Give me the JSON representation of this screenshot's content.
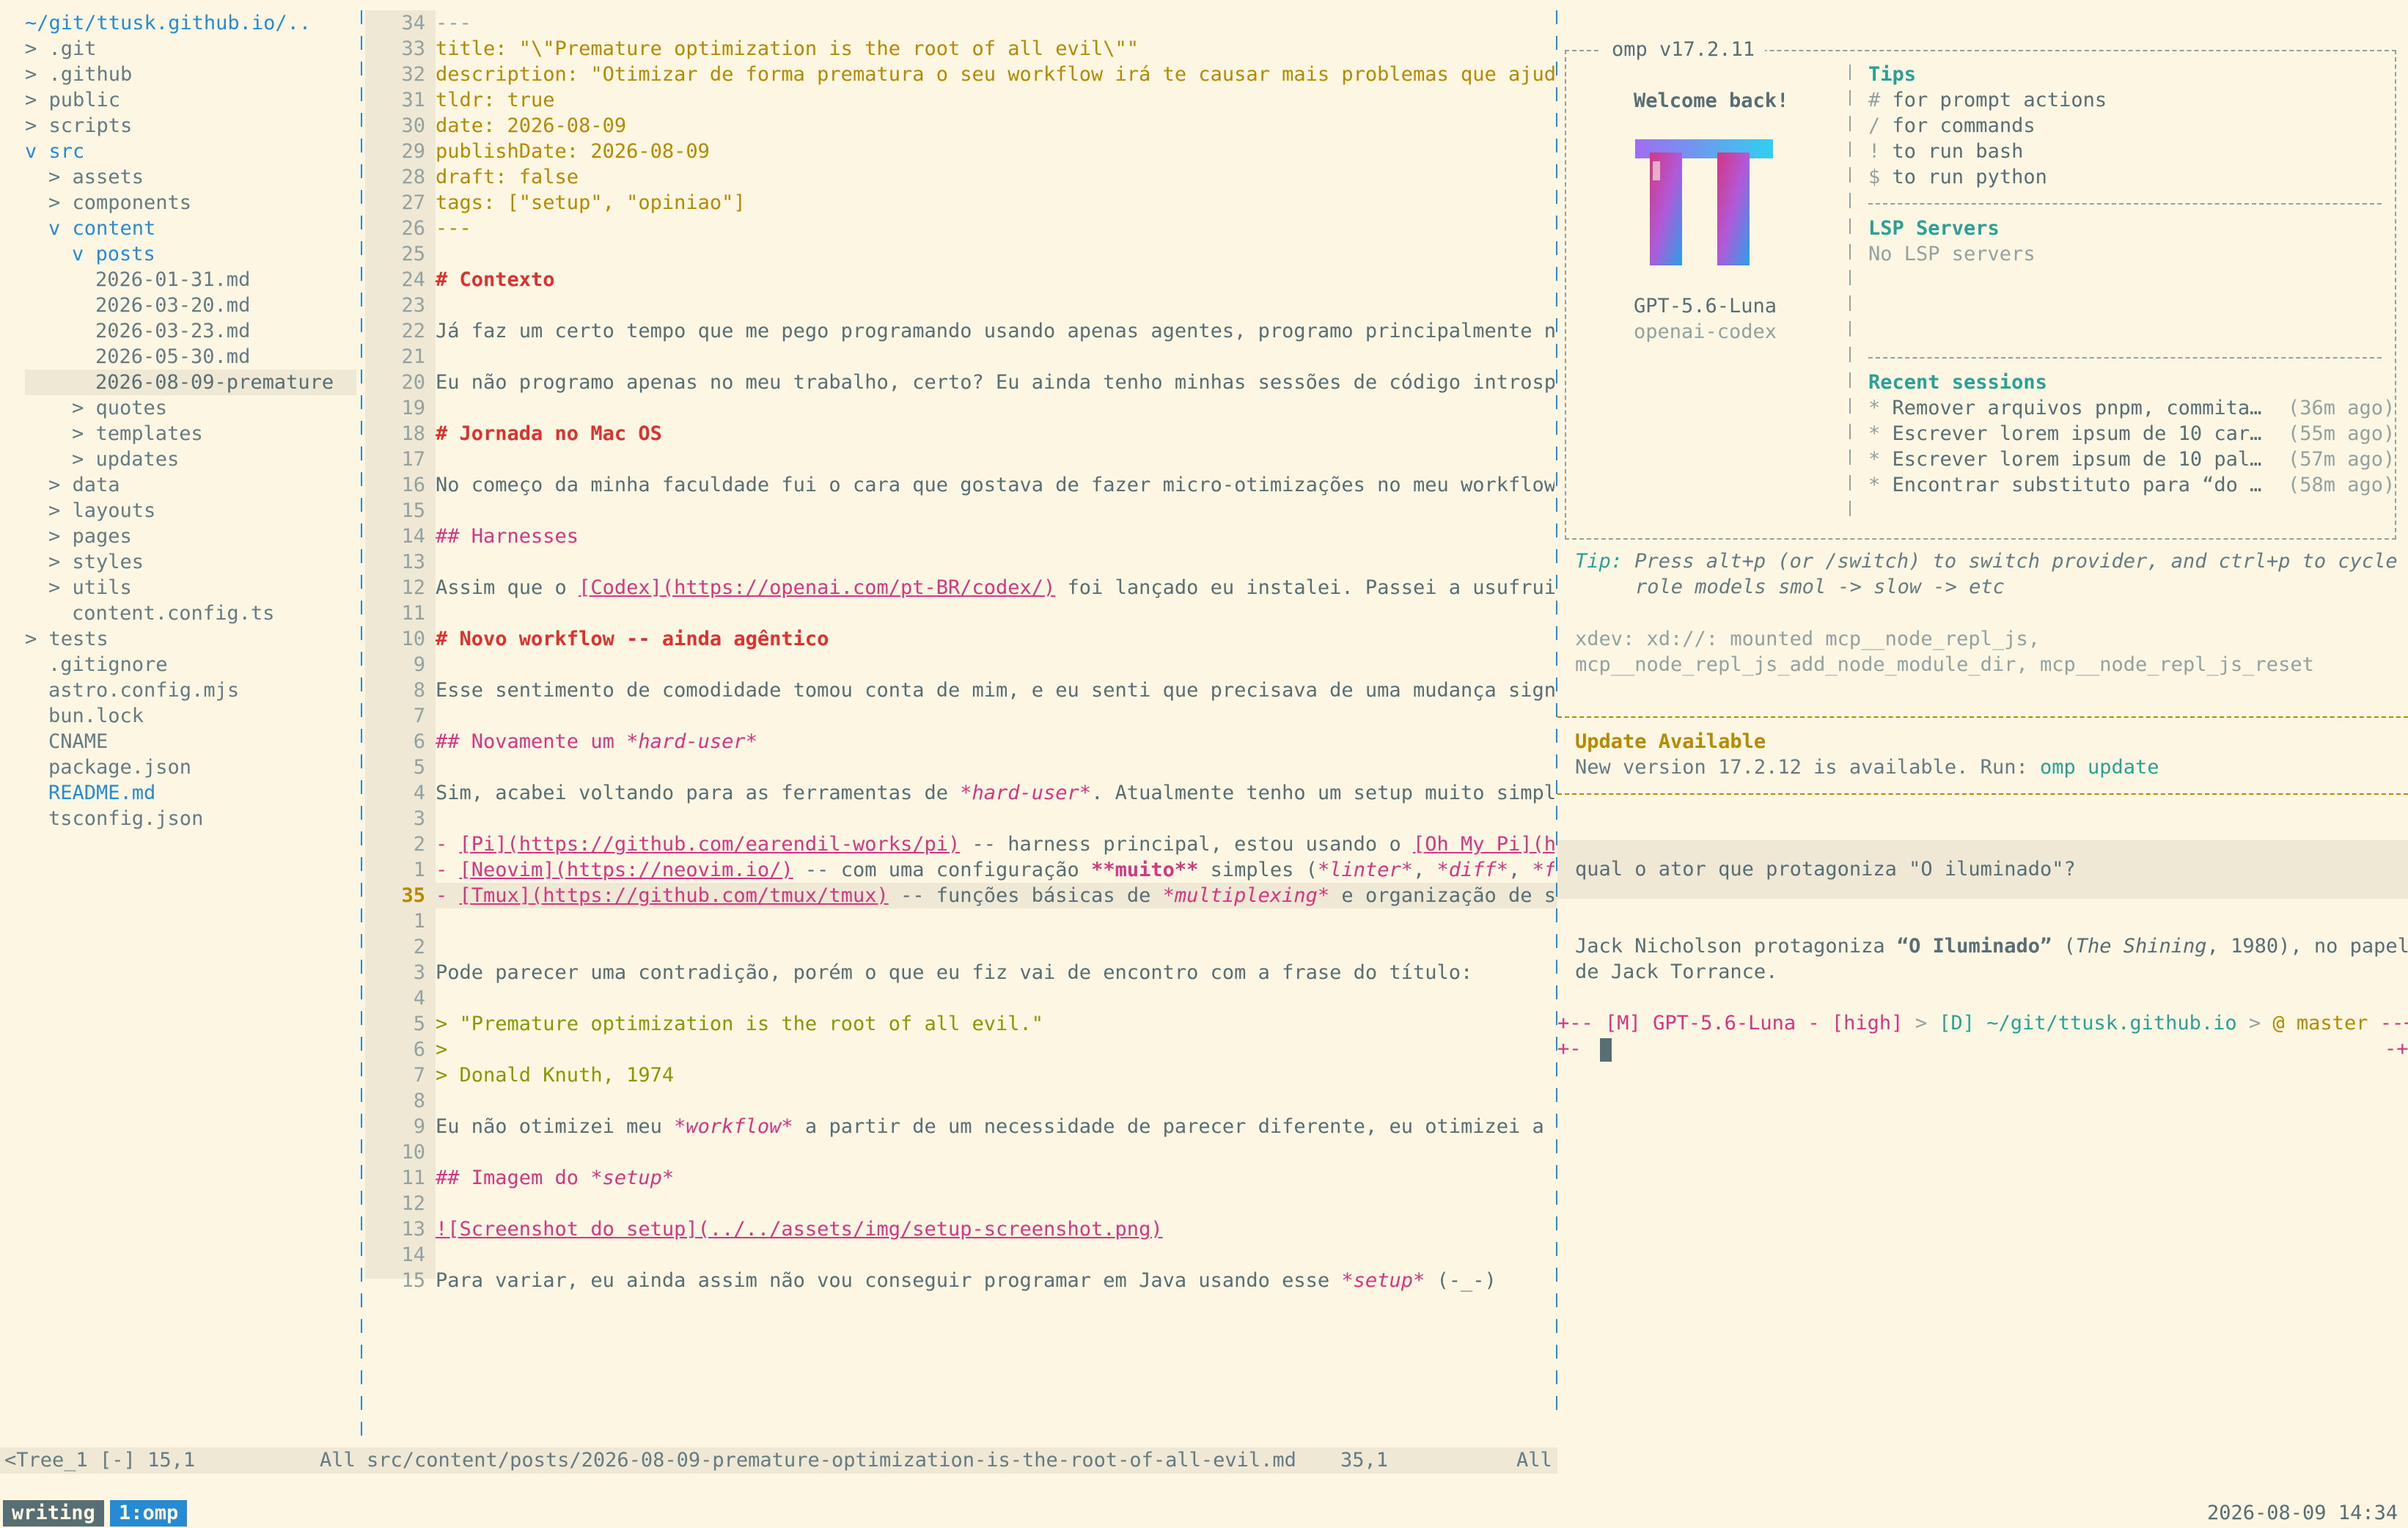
{
  "tree": {
    "root": "~/git/ttusk.github.io/..",
    "items": [
      {
        "text": "> .git",
        "indent": 1,
        "kind": "dir"
      },
      {
        "text": "> .github",
        "indent": 1,
        "kind": "dir"
      },
      {
        "text": "> public",
        "indent": 1,
        "kind": "dir"
      },
      {
        "text": "> scripts",
        "indent": 1,
        "kind": "dir"
      },
      {
        "text": "v src",
        "indent": 1,
        "kind": "open"
      },
      {
        "text": "> assets",
        "indent": 2,
        "kind": "dir"
      },
      {
        "text": "> components",
        "indent": 2,
        "kind": "dir"
      },
      {
        "text": "v content",
        "indent": 2,
        "kind": "open"
      },
      {
        "text": "v posts",
        "indent": 3,
        "kind": "open"
      },
      {
        "text": "2026-01-31.md",
        "indent": 4,
        "kind": "file"
      },
      {
        "text": "2026-03-20.md",
        "indent": 4,
        "kind": "file"
      },
      {
        "text": "2026-03-23.md",
        "indent": 4,
        "kind": "file"
      },
      {
        "text": "2026-05-30.md",
        "indent": 4,
        "kind": "file"
      },
      {
        "text": "2026-08-09-premature",
        "indent": 4,
        "kind": "current"
      },
      {
        "text": "> quotes",
        "indent": 3,
        "kind": "dir"
      },
      {
        "text": "> templates",
        "indent": 3,
        "kind": "dir"
      },
      {
        "text": "> updates",
        "indent": 3,
        "kind": "dir"
      },
      {
        "text": "> data",
        "indent": 2,
        "kind": "dir"
      },
      {
        "text": "> layouts",
        "indent": 2,
        "kind": "dir"
      },
      {
        "text": "> pages",
        "indent": 2,
        "kind": "dir"
      },
      {
        "text": "> styles",
        "indent": 2,
        "kind": "dir"
      },
      {
        "text": "> utils",
        "indent": 2,
        "kind": "dir"
      },
      {
        "text": "content.config.ts",
        "indent": 3,
        "kind": "file"
      },
      {
        "text": "> tests",
        "indent": 1,
        "kind": "dir"
      },
      {
        "text": ".gitignore",
        "indent": 2,
        "kind": "file"
      },
      {
        "text": "astro.config.mjs",
        "indent": 2,
        "kind": "file"
      },
      {
        "text": "bun.lock",
        "indent": 2,
        "kind": "file"
      },
      {
        "text": "CNAME",
        "indent": 2,
        "kind": "file"
      },
      {
        "text": "package.json",
        "indent": 2,
        "kind": "file"
      },
      {
        "text": "README.md",
        "indent": 2,
        "kind": "readme"
      },
      {
        "text": "tsconfig.json",
        "indent": 2,
        "kind": "file"
      }
    ]
  },
  "editor": {
    "lines": [
      {
        "n": "34",
        "segs": [
          {
            "t": "---",
            "c": "muted"
          }
        ]
      },
      {
        "n": "33",
        "segs": [
          {
            "t": "title: \"\\\"Premature optimization is the root of all evil\\\"\"",
            "c": "yellow"
          }
        ]
      },
      {
        "n": "32",
        "segs": [
          {
            "t": "description: \"Otimizar de forma prematura o seu workflow irá te causar mais problemas que ajuda",
            "c": "yellow"
          }
        ]
      },
      {
        "n": "31",
        "segs": [
          {
            "t": "tldr: true",
            "c": "yellow"
          }
        ]
      },
      {
        "n": "30",
        "segs": [
          {
            "t": "date: 2026-08-09",
            "c": "yellow"
          }
        ]
      },
      {
        "n": "29",
        "segs": [
          {
            "t": "publishDate: 2026-08-09",
            "c": "yellow"
          }
        ]
      },
      {
        "n": "28",
        "segs": [
          {
            "t": "draft: false",
            "c": "yellow"
          }
        ]
      },
      {
        "n": "27",
        "segs": [
          {
            "t": "tags: [\"setup\", \"opiniao\"]",
            "c": "yellow"
          }
        ]
      },
      {
        "n": "26",
        "segs": [
          {
            "t": "---",
            "c": "yellow"
          }
        ]
      },
      {
        "n": "25",
        "segs": []
      },
      {
        "n": "24",
        "segs": [
          {
            "t": "# Contexto",
            "c": "red"
          }
        ]
      },
      {
        "n": "23",
        "segs": []
      },
      {
        "n": "22",
        "segs": [
          {
            "t": "Já faz um certo tempo que me pego programando usando apenas agentes, programo principalmente no",
            "c": ""
          }
        ]
      },
      {
        "n": "21",
        "segs": []
      },
      {
        "n": "20",
        "segs": [
          {
            "t": "Eu não programo apenas no meu trabalho, certo? Eu ainda tenho minhas sessões de código introspe",
            "c": ""
          }
        ]
      },
      {
        "n": "19",
        "segs": []
      },
      {
        "n": "18",
        "segs": [
          {
            "t": "# Jornada no Mac OS",
            "c": "red"
          }
        ]
      },
      {
        "n": "17",
        "segs": []
      },
      {
        "n": "16",
        "segs": [
          {
            "t": "No começo da minha faculdade fui o cara que gostava de fazer micro-otimizações no meu workflow,",
            "c": ""
          }
        ]
      },
      {
        "n": "15",
        "segs": []
      },
      {
        "n": "14",
        "segs": [
          {
            "t": "## Harnesses",
            "c": "magenta"
          }
        ]
      },
      {
        "n": "13",
        "segs": []
      },
      {
        "n": "12",
        "segs": [
          {
            "t": "Assim que o ",
            "c": ""
          },
          {
            "t": "[Codex](https://openai.com/pt-BR/codex/)",
            "c": "link"
          },
          {
            "t": " foi lançado eu instalei. Passei a usufruir",
            "c": ""
          }
        ]
      },
      {
        "n": "11",
        "segs": []
      },
      {
        "n": "10",
        "segs": [
          {
            "t": "# Novo workflow -- ainda agêntico",
            "c": "red"
          }
        ]
      },
      {
        "n": "9",
        "segs": []
      },
      {
        "n": "8",
        "segs": [
          {
            "t": "Esse sentimento de comodidade tomou conta de mim, e eu senti que precisava de uma mudança signi",
            "c": ""
          }
        ]
      },
      {
        "n": "7",
        "segs": []
      },
      {
        "n": "6",
        "segs": [
          {
            "t": "## Novamente um ",
            "c": "magenta"
          },
          {
            "t": "*hard-user*",
            "c": "em"
          }
        ]
      },
      {
        "n": "5",
        "segs": []
      },
      {
        "n": "4",
        "segs": [
          {
            "t": "Sim, acabei voltando para as ferramentas de ",
            "c": ""
          },
          {
            "t": "*hard-user*",
            "c": "em"
          },
          {
            "t": ". Atualmente tenho um setup muito simple",
            "c": ""
          }
        ]
      },
      {
        "n": "3",
        "segs": []
      },
      {
        "n": "2",
        "segs": [
          {
            "t": "- ",
            "c": "magenta"
          },
          {
            "t": "[Pi](https://github.com/earendil-works/pi)",
            "c": "link"
          },
          {
            "t": " -- harness principal, estou usando o ",
            "c": ""
          },
          {
            "t": "[Oh My Pi](ht",
            "c": "link"
          }
        ]
      },
      {
        "n": "1",
        "segs": [
          {
            "t": "- ",
            "c": "magenta"
          },
          {
            "t": "[Neovim](https://neovim.io/)",
            "c": "link"
          },
          {
            "t": " -- com uma configuração ",
            "c": ""
          },
          {
            "t": "**muito**",
            "c": "strong"
          },
          {
            "t": " simples (",
            "c": ""
          },
          {
            "t": "*linter*",
            "c": "em"
          },
          {
            "t": ", ",
            "c": ""
          },
          {
            "t": "*diff*",
            "c": "em"
          },
          {
            "t": ", ",
            "c": ""
          },
          {
            "t": "*fi",
            "c": "em"
          }
        ]
      },
      {
        "n": "35",
        "cur": true,
        "segs": [
          {
            "t": "- ",
            "c": "magenta"
          },
          {
            "t": "[Tmux](https://github.com/tmux/tmux)",
            "c": "link"
          },
          {
            "t": " -- funções básicas de ",
            "c": ""
          },
          {
            "t": "*multiplexing*",
            "c": "em"
          },
          {
            "t": " e organização de se",
            "c": ""
          }
        ]
      },
      {
        "n": "1",
        "segs": []
      },
      {
        "n": "2",
        "segs": []
      },
      {
        "n": "3",
        "segs": [
          {
            "t": "Pode parecer uma contradição, porém o que eu fiz vai de encontro com a frase do título:",
            "c": ""
          }
        ]
      },
      {
        "n": "4",
        "segs": []
      },
      {
        "n": "5",
        "segs": [
          {
            "t": "> \"Premature optimization is the root of all evil.\"",
            "c": "green"
          }
        ]
      },
      {
        "n": "6",
        "segs": [
          {
            "t": ">",
            "c": "green"
          }
        ]
      },
      {
        "n": "7",
        "segs": [
          {
            "t": "> Donald Knuth, 1974",
            "c": "green"
          }
        ]
      },
      {
        "n": "8",
        "segs": []
      },
      {
        "n": "9",
        "segs": [
          {
            "t": "Eu não otimizei meu ",
            "c": ""
          },
          {
            "t": "*workflow*",
            "c": "em"
          },
          {
            "t": " a partir de um necessidade de parecer diferente, eu otimizei a p",
            "c": ""
          }
        ]
      },
      {
        "n": "10",
        "segs": []
      },
      {
        "n": "11",
        "segs": [
          {
            "t": "## Imagem do ",
            "c": "magenta"
          },
          {
            "t": "*setup*",
            "c": "em"
          }
        ]
      },
      {
        "n": "12",
        "segs": []
      },
      {
        "n": "13",
        "segs": [
          {
            "t": "![Screenshot do setup](../../assets/img/setup-screenshot.png)",
            "c": "link"
          }
        ]
      },
      {
        "n": "14",
        "segs": []
      },
      {
        "n": "15",
        "segs": [
          {
            "t": "Para variar, eu ainda assim não vou conseguir programar em Java usando esse ",
            "c": ""
          },
          {
            "t": "*setup*",
            "c": "em"
          },
          {
            "t": " (-_-)",
            "c": ""
          }
        ]
      }
    ]
  },
  "statusline": {
    "tree_name": "<Tree_1 [-] 15,1",
    "tree_pos": "All",
    "file_path": "src/content/posts/2026-08-09-premature-optimization-is-the-root-of-all-evil.md",
    "cursor": "35,1",
    "file_pos": "All"
  },
  "omp": {
    "version_title": "omp v17.2.11",
    "welcome": "Welcome back!",
    "model": "GPT-5.6-Luna",
    "provider": "openai-codex",
    "tips_title": "Tips",
    "tips": [
      {
        "key": "#",
        "text": " for prompt actions"
      },
      {
        "key": "/",
        "text": " for commands"
      },
      {
        "key": "!",
        "text": " to run bash"
      },
      {
        "key": "$",
        "text": " to run python"
      }
    ],
    "lsp_title": "LSP Servers",
    "lsp_empty": "No LSP servers",
    "recent_title": "Recent sessions",
    "recent": [
      {
        "title": "Remover arquivos pnpm, commita…",
        "age": "(36m ago)"
      },
      {
        "title": "Escrever lorem ipsum de 10 car…",
        "age": "(55m ago)"
      },
      {
        "title": "Escrever lorem ipsum de 10 pal…",
        "age": "(57m ago)"
      },
      {
        "title": "Encontrar substituto para “do …",
        "age": "(58m ago)"
      }
    ],
    "tip_label": "Tip:",
    "tip_line1": "Press alt+p (or /switch) to switch provider, and ctrl+p to cycle",
    "tip_line2": "role models smol -> slow -> etc",
    "xdev_line1": "xdev: xd://: mounted mcp__node_repl_js,",
    "xdev_line2": "mcp__node_repl_js_add_node_module_dir, mcp__node_repl_js_reset",
    "update_title": "Update Available",
    "update_text": "New version 17.2.12 is available. Run: ",
    "update_cmd": "omp update",
    "question": "qual o ator que protagoniza \"O iluminado\"?",
    "answer_a": "Jack Nicholson protagoniza ",
    "answer_b": "“O Iluminado”",
    "answer_c": " (",
    "answer_d": "The Shining",
    "answer_e": ", 1980), no papel",
    "answer_line2": "de Jack Torrance.",
    "prompt_mode": "[M]",
    "prompt_model": "GPT-5.6-Luna - [high]",
    "prompt_dir": "[D] ~/git/ttusk.github.io",
    "prompt_branch": "@ master"
  },
  "tmux": {
    "session": "writing",
    "window": "1:omp",
    "clock": "2026-08-09 14:34"
  }
}
